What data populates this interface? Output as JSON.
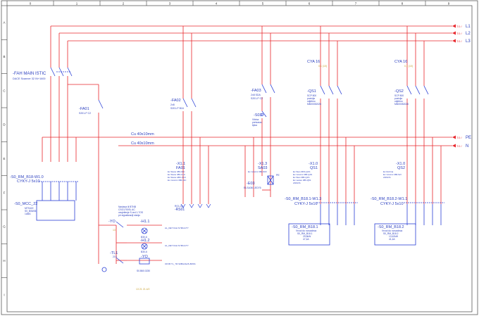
{
  "frame": {
    "columns": [
      "0",
      "1",
      "2",
      "3",
      "4",
      "5",
      "6",
      "7",
      "8",
      "9"
    ],
    "rows": [
      "A",
      "B",
      "C",
      "D",
      "E",
      "F",
      "G",
      "H",
      "I"
    ]
  },
  "colors": {
    "phase": "#e8262b",
    "wire": "#2a3fd6",
    "text": "#2b3fbf",
    "grid": "#444444",
    "accent": "#c8a030"
  },
  "buses": {
    "L1": "L1",
    "L2": "L2",
    "L3": "L3",
    "PE": "PE",
    "N": "N",
    "ref_prefix": "T.0 /",
    "pe_bar": "Cu 40x10mm",
    "n_bar": "Cu 40x10mm"
  },
  "main_switch": {
    "tag": "-FAH MAIN ISTIC",
    "desc": "DACE Scanner 32 IN+1600"
  },
  "fa01": {
    "tag": "-FA01",
    "desc": "S201-P C2"
  },
  "fa02": {
    "tag": "-FA02",
    "desc1": "2x8",
    "desc2": "S201-P B16"
  },
  "fa03": {
    "tag": "-FA03",
    "desc1": "2x8 SDA",
    "desc2": "S201-P C2"
  },
  "s03": {
    "tag": "-S03",
    "desc1": "Vitrina",
    "desc2": "pretvarac",
    "desc3": "tipka"
  },
  "q51": {
    "cya": "CYA 16",
    "tag": "-QS1",
    "sub": "0,1 (10)",
    "desc1": "SCP 800",
    "desc2": "pozicija",
    "desc3": "odjebno",
    "desc4": "MBX0052026"
  },
  "q52": {
    "cya": "CYA 16",
    "tag": "-QS2",
    "sub": "0,1 (10)",
    "desc1": "SCP 800",
    "desc2": "pozicija",
    "desc3": "odjebno",
    "desc4": "MBX0052026"
  },
  "x11": {
    "tag": "-X1.1",
    "name": "FA01",
    "lines": [
      "Ex Stano 386-01C",
      "Ex Stano 386-C1C",
      "Ex Stano ABC-C1C",
      "Ex zvucnic 386-11C"
    ]
  },
  "x13": {
    "tag": "-X1.3",
    "name": "SA03",
    "lines": [
      "Ex zvucnic 380-S03"
    ]
  },
  "x10a": {
    "tag": "-X1.0",
    "name": "QS1",
    "lines": [
      "Ex Stan ZDS-Q1S",
      "Ex zvucnic 386-Q1S",
      "Ex Stan 386-Q1S",
      "Ex vestex 386-Q51",
      "ANSOS"
    ]
  },
  "x10b": {
    "tag": "-X1.0",
    "name": "QS2",
    "lines": [
      "Ex bimbna",
      "Ex zvucnic 386-S2I",
      "ANSOS"
    ]
  },
  "e03": {
    "tag": "-E03",
    "desc": "ELSA36 LED76"
  },
  "pe_label": "PE",
  "cable_mcc": {
    "tag": "-S0_RM_B18-W1.0",
    "type": "CYKY-J 5x10"
  },
  "cable_w13": {
    "tag": "-S0_RM_B18.1-W1.3",
    "type": "CYKY-J 5x16"
  },
  "cable_w1": {
    "tag": "-S0_RM_B18.2-W1.1",
    "type": "CYKY-J 5x10"
  },
  "mcc": {
    "tag": "-S0_MCC_22",
    "desc1": "MTS422",
    "desc2": "S0_B06/06",
    "desc3": "1ABA"
  },
  "rm1": {
    "tag": "-S0_RM_B18.1",
    "desc1": "Vrvod do rozvadeca",
    "desc2": "S0_RM_B18.1",
    "desc3": "29,5kW",
    "desc4": "47,4A"
  },
  "rm2": {
    "tag": "-S0_RM_B18.2",
    "desc1": "Vrvod do rozvadeca",
    "desc2": "S0_RM_B18.2",
    "desc3": "13,42kW",
    "desc4": "41,4A"
  },
  "ctrl_note": [
    "Nastava ili BTNB",
    "CSO1700SL AC",
    "osvjetlenje S-red 1-7OS",
    "pri signalizaciji stanju"
  ],
  "rsg": {
    "line1": "RO1-Ob",
    "line2": "-RS01"
  },
  "yo_tag": "-YO",
  "yo_desc": "13",
  "h1": {
    "tag": "-H1.1",
    "desc": "B30-6"
  },
  "h2": {
    "tag": "-H1.2",
    "desc": "B30-6"
  },
  "tl": {
    "tag": "-TL1",
    "desc": "21V"
  },
  "yo2": {
    "tag": "-YO",
    "desc": "S0.B60.0230"
  },
  "notes": {
    "n1": "AL_DET FAH SYMULITY",
    "n2": "AL_DET FAH SYMULITY",
    "n3": "OFVB TL_ 56 S0BG4G2S-B0SS"
  },
  "footer_note": "13  21  21.4/2"
}
